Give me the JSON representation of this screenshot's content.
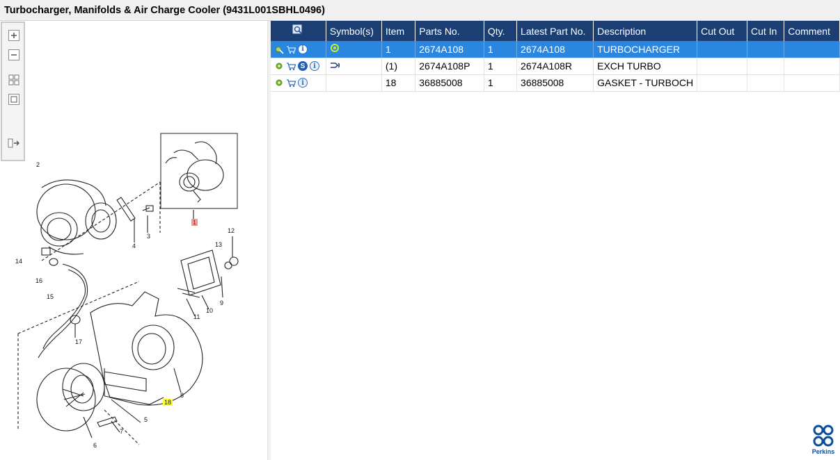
{
  "title": "Turbocharger, Manifolds & Air Charge Cooler (9431L001SBHL0496)",
  "toolbar": {
    "zoom_in": "zoom-in-icon",
    "zoom_out": "zoom-out-icon",
    "fit": "fit-all-icon",
    "actual": "actual-size-icon",
    "panel": "toggle-panel-icon"
  },
  "diagram": {
    "callouts": [
      "1",
      "2",
      "3",
      "4",
      "5",
      "6",
      "7",
      "8",
      "9",
      "10",
      "11",
      "12",
      "13",
      "14",
      "15",
      "16",
      "17",
      "18"
    ]
  },
  "grid": {
    "headers": [
      "",
      "Symbol(s)",
      "Item",
      "Parts No.",
      "Qty.",
      "Latest Part No.",
      "Description",
      "Cut Out",
      "Cut In",
      "Comment"
    ],
    "rows": [
      {
        "item": "1",
        "part": "2674A108",
        "qty": "1",
        "latest": "2674A108",
        "desc": "TURBOCHARGER",
        "cut_out": "",
        "cut_in": "",
        "comment": ""
      },
      {
        "item": "(1)",
        "part": "2674A108P",
        "qty": "1",
        "latest": "2674A108R",
        "desc": "EXCH TURBO",
        "cut_out": "",
        "cut_in": "",
        "comment": ""
      },
      {
        "item": "18",
        "part": "36885008",
        "qty": "1",
        "latest": "36885008",
        "desc": "GASKET - TURBOCH",
        "cut_out": "",
        "cut_in": "",
        "comment": ""
      }
    ]
  },
  "logo": {
    "text": "Perkins"
  },
  "colors": {
    "header": "#1b3f73",
    "selected": "#2b86e0",
    "logo": "#0a4d9a"
  }
}
